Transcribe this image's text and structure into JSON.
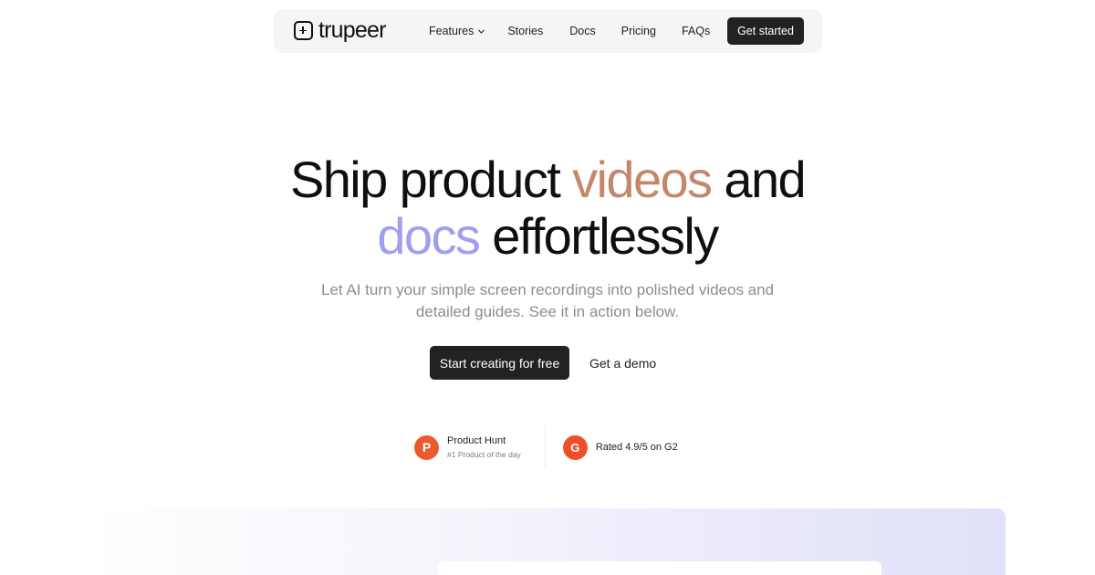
{
  "nav": {
    "logo_text": "trupeer",
    "links": [
      {
        "label": "Features",
        "has_dropdown": true
      },
      {
        "label": "Stories"
      },
      {
        "label": "Docs"
      },
      {
        "label": "Pricing"
      },
      {
        "label": "FAQs"
      }
    ],
    "cta_label": "Get started"
  },
  "hero": {
    "title_part1": "Ship product ",
    "title_accent1": "videos",
    "title_part2": " and",
    "title_accent2": "docs",
    "title_part3": " effortlessly",
    "subtitle_line1": "Let AI turn your simple screen recordings into polished videos and",
    "subtitle_line2": "detailed guides. See it in action below.",
    "primary_cta": "Start creating for free",
    "secondary_cta": "Get a demo"
  },
  "badges": {
    "product_hunt": {
      "icon_letter": "P",
      "title": "Product Hunt",
      "subtitle": "#1 Product of the day"
    },
    "g2": {
      "icon_letter": "G",
      "text": "Rated 4.9/5 on G2"
    }
  },
  "colors": {
    "accent_copper": "#c58769",
    "accent_lilac": "#9f9ff2",
    "dark_button": "#222222",
    "product_hunt": "#ea5a2c",
    "g2": "#ef4e28"
  },
  "icons": {
    "logo": "square-plus-icon",
    "dropdown": "chevron-down-icon"
  }
}
